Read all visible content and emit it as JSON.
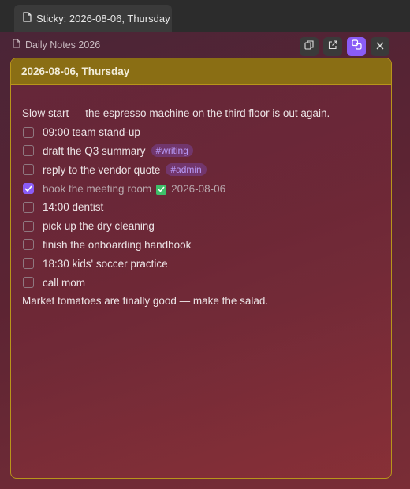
{
  "tab": {
    "title": "Sticky: 2026-08-06, Thursday"
  },
  "breadcrumb": {
    "label": "Daily Notes 2026"
  },
  "toolbar": {
    "buttons": [
      "copy-icon",
      "open-external-icon",
      "link-icon",
      "close-icon"
    ],
    "active": "link-icon"
  },
  "note": {
    "header": "2026-08-06, Thursday",
    "intro": "Slow start — the espresso machine on the third floor is out again.",
    "tasks": [
      {
        "text": "09:00 team stand-up",
        "done": false,
        "tag": ""
      },
      {
        "text": "draft the Q3 summary",
        "done": false,
        "tag": "#writing"
      },
      {
        "text": "reply to the vendor quote",
        "done": false,
        "tag": "#admin"
      },
      {
        "text": "book the meeting room",
        "done": true,
        "tag": "",
        "done_date": "2026-08-06"
      },
      {
        "text": "14:00 dentist",
        "done": false,
        "tag": ""
      },
      {
        "text": "pick up the dry cleaning",
        "done": false,
        "tag": ""
      },
      {
        "text": "finish the onboarding handbook",
        "done": false,
        "tag": ""
      },
      {
        "text": "18:30 kids' soccer practice",
        "done": false,
        "tag": ""
      },
      {
        "text": "call mom",
        "done": false,
        "tag": ""
      }
    ],
    "outro": "Market tomatoes are finally good — make the salad."
  },
  "colors": {
    "accent": "#8a5cf6",
    "header_bg": "#8a6e14",
    "card_border": "#b8951a",
    "done_emoji": "#3fbf6a"
  }
}
